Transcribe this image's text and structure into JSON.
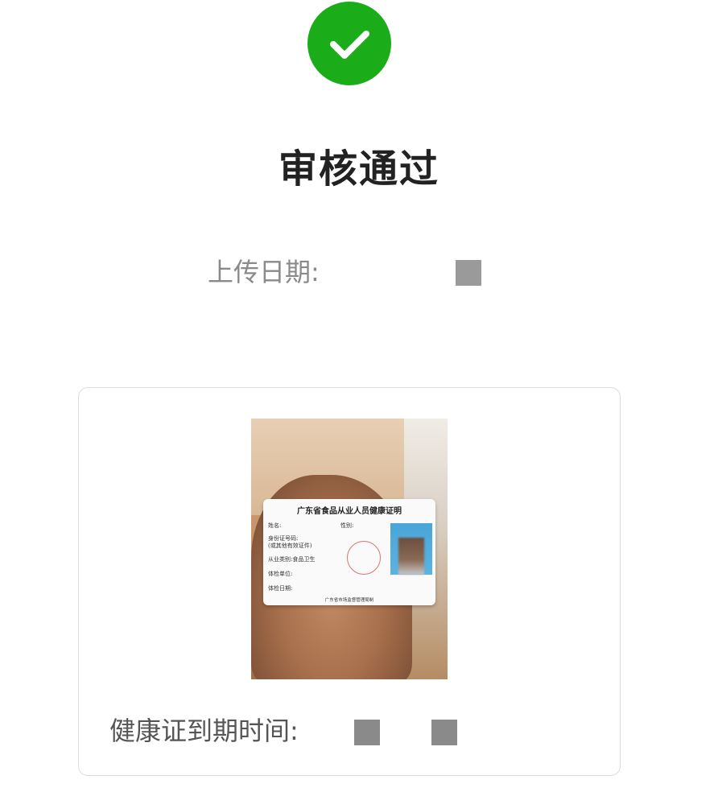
{
  "status": {
    "icon": "check-icon",
    "color": "#1aad19",
    "title": "审核通过"
  },
  "upload": {
    "label": "上传日期:"
  },
  "card": {
    "photo": {
      "card_title": "广东省食品从业人员健康证明",
      "fields": [
        {
          "label": "姓名:"
        },
        {
          "label": "性别:"
        },
        {
          "label": "身份证号码:"
        },
        {
          "label": "(或其他有效证件)"
        },
        {
          "label": "从业类别:",
          "value": "食品卫生"
        },
        {
          "label": "体检单位:"
        },
        {
          "label": "体检日期:"
        }
      ],
      "issuer": "广东省市场监督管理局制"
    },
    "expiry": {
      "label": "健康证到期时间:"
    }
  }
}
